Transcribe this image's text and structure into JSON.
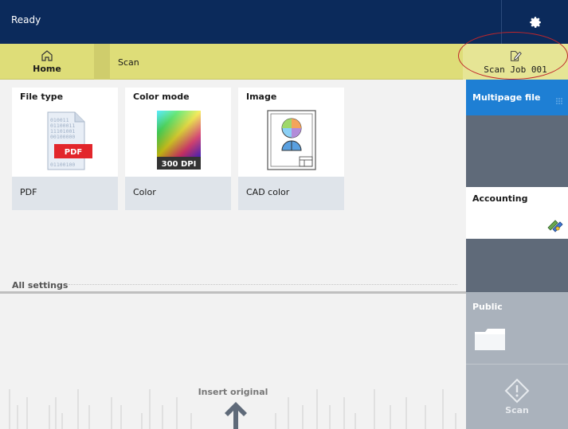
{
  "status": {
    "text": "Ready"
  },
  "nav": {
    "home_label": "Home",
    "section_label": "Scan",
    "job_label": "Scan Job 001"
  },
  "cards": [
    {
      "title": "File type",
      "value": "PDF",
      "badge": "PDF",
      "thumb_icon": "pdf-file-icon"
    },
    {
      "title": "Color mode",
      "value": "Color",
      "badge": "300 DPI",
      "thumb_icon": "color-gradient-icon"
    },
    {
      "title": "Image",
      "value": "CAD color",
      "thumb_icon": "cad-drawing-icon"
    }
  ],
  "all_settings": "All settings",
  "insert": {
    "text": "Insert original"
  },
  "right_panel": {
    "multipage": "Multipage file",
    "accounting": "Accounting",
    "public": "Public",
    "scan": "Scan"
  },
  "colors": {
    "status_bar": "#0b2a5b",
    "nav_bar": "#dedd78",
    "accent_blue": "#1e7fd4",
    "panel_gray": "#5f6a79",
    "disabled_gray": "#aab2bc",
    "annotation_red": "#c0262b"
  }
}
